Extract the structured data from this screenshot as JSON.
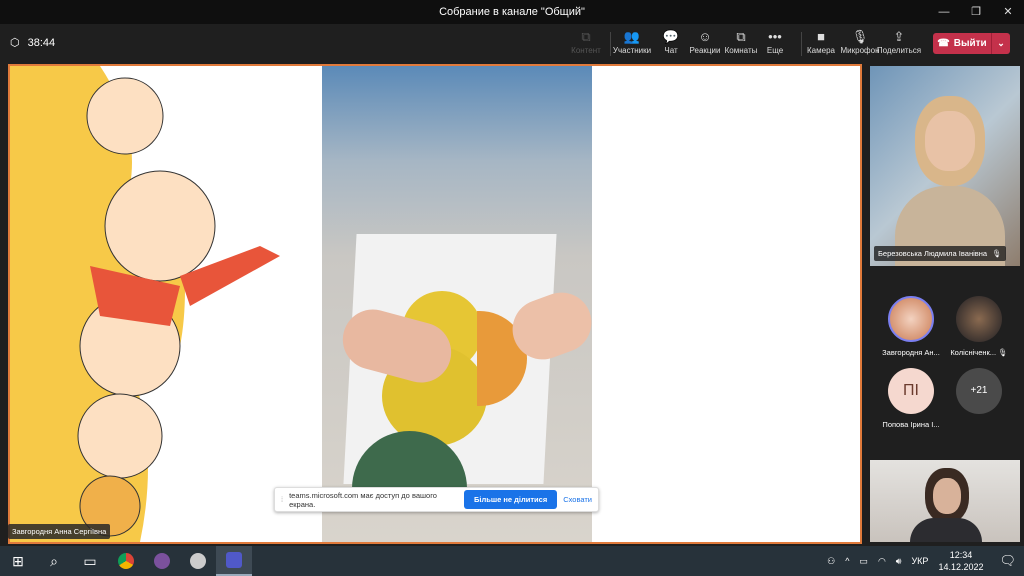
{
  "window": {
    "title": "Собрание в канале \"Общий\"",
    "controls": [
      "—",
      "❐",
      "✕"
    ]
  },
  "toolbar": {
    "timer": "38:44",
    "buttons": [
      {
        "label": "Контент",
        "icon": "share-content-icon",
        "glyph": "⧉",
        "disabled": true
      },
      {
        "label": "Участники",
        "icon": "participants-icon",
        "glyph": "👥"
      },
      {
        "label": "Чат",
        "icon": "chat-icon",
        "glyph": "💬"
      },
      {
        "label": "Реакции",
        "icon": "reactions-icon",
        "glyph": "☺"
      },
      {
        "label": "Комнаты",
        "icon": "rooms-icon",
        "glyph": "⧉"
      },
      {
        "label": "Еще",
        "icon": "more-icon",
        "glyph": "•••"
      },
      {
        "label": "Камера",
        "icon": "camera-icon",
        "glyph": "■"
      },
      {
        "label": "Микрофон",
        "icon": "mic-off-icon",
        "glyph": "🎙"
      },
      {
        "label": "Поделиться",
        "icon": "share-icon",
        "glyph": "⇪"
      }
    ],
    "leave": "Выйти"
  },
  "presenter": "Завгородня Анна Сергіївна",
  "sharebar": {
    "text": "teams.microsoft.com має доступ до вашого екрана.",
    "stop": "Більше не ділитися",
    "hide": "Сховати"
  },
  "participants": {
    "main": "Березовська Людмила Іванівна",
    "list": [
      {
        "name": "Завгородня Ан...",
        "initials": ""
      },
      {
        "name": "Колісніченк...",
        "initials": ""
      },
      {
        "name": "Попова Ірина І...",
        "initials": "ПІ"
      }
    ],
    "more": "+21"
  },
  "taskbar": {
    "lang": "УКР",
    "time": "12:34",
    "date": "14.12.2022"
  },
  "colors": {
    "leave": "#c4314b",
    "accent": "#1a73e8",
    "border": "#e07a3b"
  }
}
